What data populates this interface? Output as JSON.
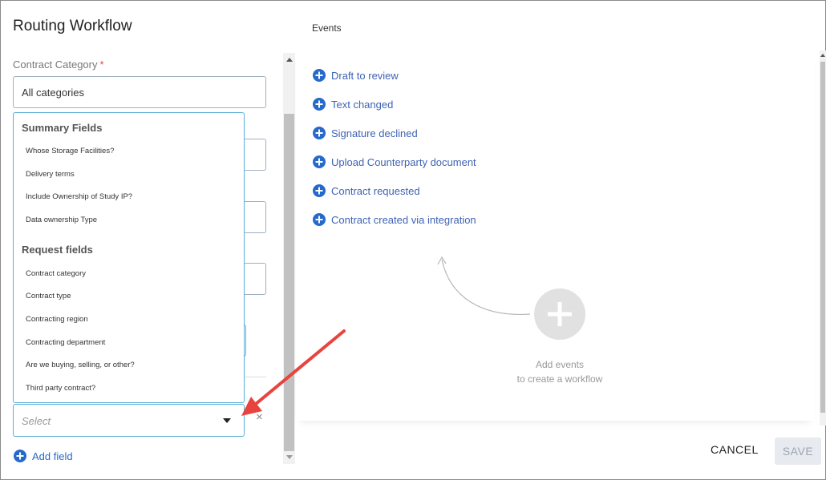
{
  "header": {
    "title": "Routing Workflow"
  },
  "left": {
    "category_label": "Contract Category",
    "required_mark": "*",
    "category_value": "All categories",
    "dropdown": {
      "groups": [
        {
          "title": "Summary Fields",
          "items": [
            "Whose Storage Facilities?",
            "Delivery terms",
            "Include Ownership of Study IP?",
            "Data ownership Type"
          ]
        },
        {
          "title": "Request fields",
          "items": [
            "Contract category",
            "Contract type",
            "Contracting region",
            "Contracting department",
            "Are we buying, selling, or other?",
            "Third party contract?"
          ]
        }
      ]
    },
    "select_placeholder": "Select",
    "clear_symbol": "×",
    "add_field_label": "Add field"
  },
  "events": {
    "title": "Events",
    "items": [
      "Draft to review",
      "Text changed",
      "Signature declined",
      "Upload Counterparty document",
      "Contract requested",
      "Contract created via integration"
    ],
    "empty_hint_line1": "Add events",
    "empty_hint_line2": "to create a workflow"
  },
  "footer": {
    "cancel_label": "CANCEL",
    "save_label": "SAVE"
  },
  "colors": {
    "accent": "#2669cc",
    "link": "#3f63b3",
    "focus_border": "#5ab0d6",
    "annotation_arrow": "#e8443f"
  }
}
